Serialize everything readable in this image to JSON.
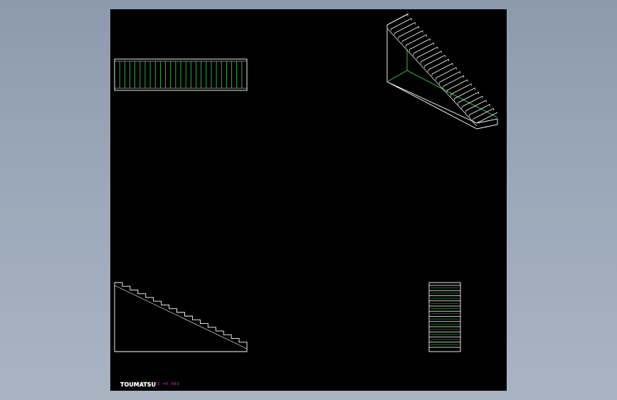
{
  "footer": {
    "logo_text": "TOUMATSU",
    "scale_text": "23 =0.003"
  },
  "colors": {
    "background": "#8d9aad",
    "viewport": "#000000",
    "line_white": "#ffffff",
    "line_green": "#39d353",
    "text_magenta": "#d633d6"
  },
  "views": {
    "top_view": {
      "steps": 26
    },
    "side_view": {
      "steps": 17
    },
    "front_view": {
      "treads": 12
    },
    "iso_view": {
      "steps": 24
    }
  }
}
